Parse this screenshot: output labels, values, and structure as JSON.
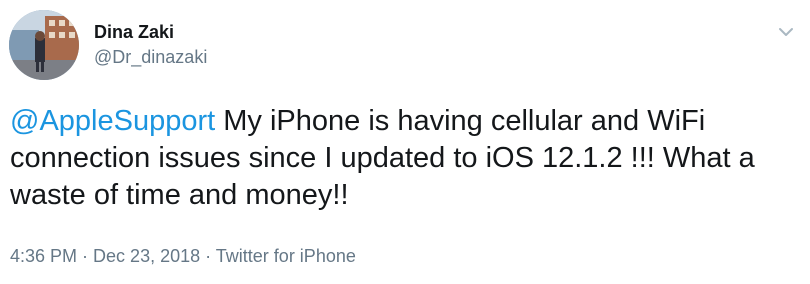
{
  "tweet": {
    "display_name": "Dina Zaki",
    "handle": "@Dr_dinazaki",
    "mention": "@AppleSupport",
    "body": " My iPhone is having cellular and WiFi connection issues since I updated to iOS 12.1.2 !!! What a waste of time and money!!",
    "time": "4:36 PM",
    "date": "Dec 23, 2018",
    "source": "Twitter for iPhone",
    "separator": " · "
  },
  "colors": {
    "mention": "#1b95e0",
    "secondary_text": "#657786",
    "primary_text": "#14171a"
  },
  "icons": {
    "caret": "chevron-down-icon",
    "avatar": "profile-photo"
  }
}
